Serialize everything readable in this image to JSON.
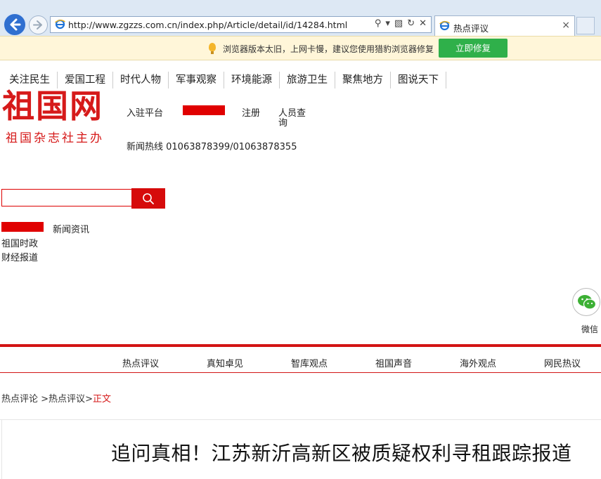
{
  "browser": {
    "url": "http://www.zgzzs.com.cn/index.php/Article/detail/id/14284.html",
    "tab_title": "热点评议",
    "tab_close": "×"
  },
  "warning": {
    "text": "浏览器版本太旧，上网卡慢，建议您使用猎豹浏览器修复",
    "button": "立即修复",
    "button_color": "#2fb04a"
  },
  "topnav": [
    "关注民生",
    "爱国工程",
    "时代人物",
    "军事观察",
    "环境能源",
    "旅游卫生",
    "聚焦地方",
    "图说天下"
  ],
  "logo": {
    "main": "祖国网",
    "sub": "祖国杂志社主办",
    "color": "#d61a1a"
  },
  "header_links": {
    "settle": "入驻平台",
    "register": "注册",
    "person_query_1": "人员查",
    "person_query_2": "询",
    "hotline": "新闻热线 01063878399/01063878355"
  },
  "search": {
    "placeholder": ""
  },
  "side_links": {
    "news": "新闻资讯",
    "politics": "祖国时政",
    "finance": "财经报道"
  },
  "wechat": {
    "label": "微信"
  },
  "channels": [
    "热点评议",
    "真知卓见",
    "智库观点",
    "祖国声音",
    "海外观点",
    "网民热议"
  ],
  "breadcrumb": {
    "home": "热点评论",
    "sep1": " >",
    "section": "热点评议",
    "sep2": ">",
    "current": "正文"
  },
  "article": {
    "title": "追问真相！江苏新沂高新区被质疑权利寻租跟踪报道"
  }
}
